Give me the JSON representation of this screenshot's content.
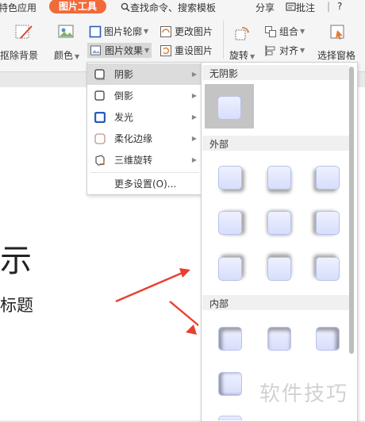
{
  "tabs": {
    "special_apps": "特色应用",
    "picture_tools": "图片工具",
    "search": "查找命令、搜索模板",
    "share": "分享",
    "comment": "批注",
    "help": "?"
  },
  "toolbar": {
    "remove_bg": "抠除背景",
    "color": "颜色",
    "outline": "图片轮廓",
    "effects": "图片效果",
    "change_pic": "更改图片",
    "reset_pic": "重设图片",
    "rotate": "旋转",
    "group": "组合",
    "align": "对齐",
    "select_pane": "选择窗格"
  },
  "effects_menu": {
    "items": [
      {
        "label": "阴影",
        "icon": "shadow-effect-icon"
      },
      {
        "label": "倒影",
        "icon": "reflection-effect-icon"
      },
      {
        "label": "发光",
        "icon": "glow-effect-icon"
      },
      {
        "label": "柔化边缘",
        "icon": "soft-edge-effect-icon"
      },
      {
        "label": "三维旋转",
        "icon": "3d-rotation-icon"
      }
    ],
    "more": "更多设置(O)..."
  },
  "shadow_gallery": {
    "no_shadow": "无阴影",
    "outer": "外部",
    "inner": "内部"
  },
  "document": {
    "big_char": "示",
    "subtitle": "标题"
  },
  "watermark": "软件技巧",
  "colors": {
    "accent": "#f06a3a",
    "arrow": "#e8402f",
    "swatch_fill": "#dde3fc"
  }
}
